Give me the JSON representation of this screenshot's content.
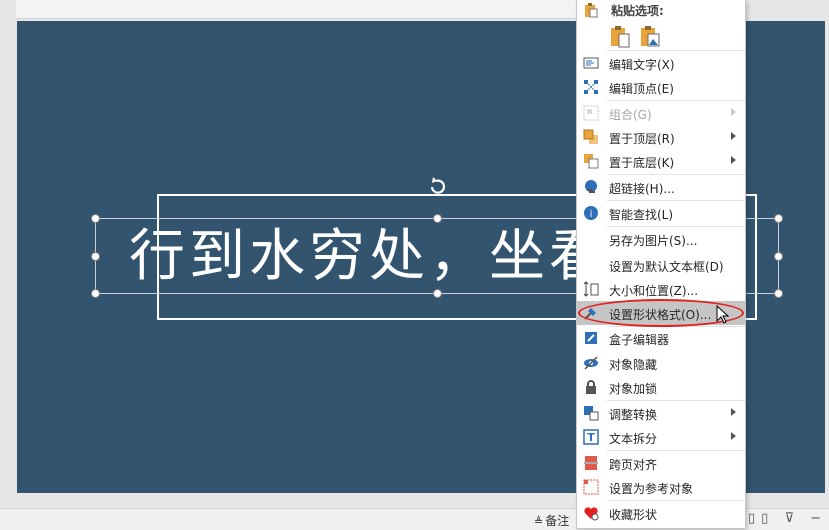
{
  "slide": {
    "text": "行到水穷处，坐看",
    "background_color": "#33546f"
  },
  "status_bar": {
    "notes_label": "备注"
  },
  "context_menu": {
    "paste_header": "粘贴选项:",
    "paste_options": [
      "paste-keep-formatting-icon",
      "paste-picture-icon"
    ],
    "items": [
      {
        "label": "编辑文字(X)",
        "icon": "edit-text-icon"
      },
      {
        "label": "编辑顶点(E)",
        "icon": "edit-points-icon"
      },
      {
        "label": "组合(G)",
        "icon": "group-icon",
        "disabled": true,
        "submenu": true
      },
      {
        "label": "置于顶层(R)",
        "icon": "bring-to-front-icon",
        "submenu": true
      },
      {
        "label": "置于底层(K)",
        "icon": "send-to-back-icon",
        "submenu": true
      },
      {
        "label": "超链接(H)...",
        "icon": "hyperlink-icon"
      },
      {
        "label": "智能查找(L)",
        "icon": "smart-lookup-icon"
      },
      {
        "label": "另存为图片(S)...",
        "icon": ""
      },
      {
        "label": "设置为默认文本框(D)",
        "icon": ""
      },
      {
        "label": "大小和位置(Z)...",
        "icon": "size-position-icon"
      },
      {
        "label": "设置形状格式(O)...",
        "icon": "format-shape-icon",
        "highlighted": true
      },
      {
        "label": "盒子编辑器",
        "icon": "box-editor-icon"
      },
      {
        "label": "对象隐藏",
        "icon": "hide-object-icon"
      },
      {
        "label": "对象加锁",
        "icon": "lock-icon"
      },
      {
        "label": "调整转换",
        "icon": "convert-icon",
        "submenu": true
      },
      {
        "label": "文本拆分",
        "icon": "text-split-icon",
        "submenu": true
      },
      {
        "label": "跨页对齐",
        "icon": "cross-page-align-icon"
      },
      {
        "label": "设置为参考对象",
        "icon": "reference-object-icon"
      },
      {
        "label": "收藏形状",
        "icon": "favorite-shape-icon"
      }
    ]
  },
  "colors": {
    "highlight_ring": "#e0211d",
    "menu_hover": "#c5c5c5",
    "accent_blue": "#2f6fb5",
    "accent_orange": "#e8a33a"
  }
}
